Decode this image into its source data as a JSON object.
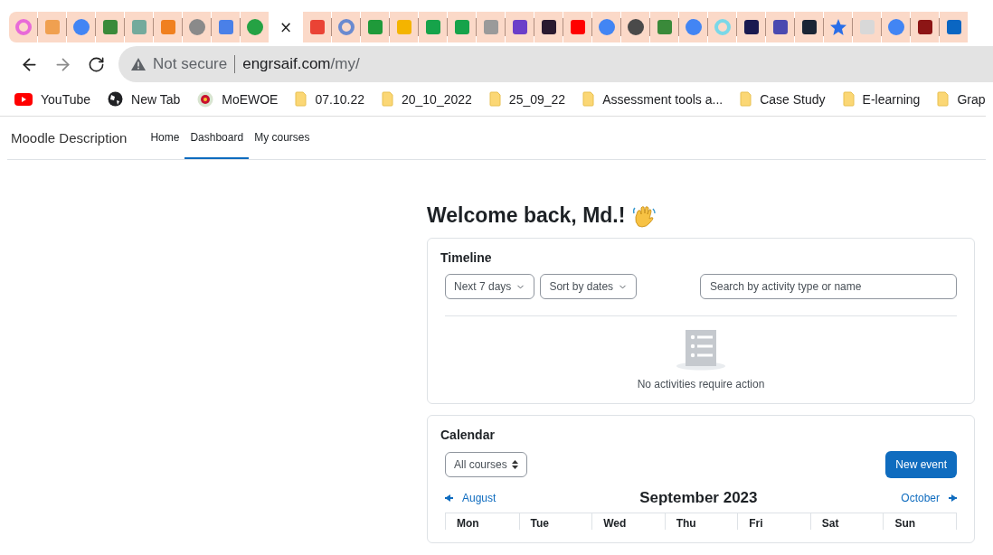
{
  "browser": {
    "tabs": [
      {
        "kind": "ring",
        "color": "#e86bd8",
        "selected": false
      },
      {
        "kind": "square",
        "color": "#f0a050",
        "selected": false
      },
      {
        "kind": "circle",
        "color": "#4285f4",
        "selected": false
      },
      {
        "kind": "square",
        "color": "#3a8a3a",
        "selected": false
      },
      {
        "kind": "square",
        "color": "#74aa9c",
        "selected": false
      },
      {
        "kind": "square",
        "color": "#f08020",
        "selected": false
      },
      {
        "kind": "circle",
        "color": "#8a8a8a",
        "selected": false
      },
      {
        "kind": "square",
        "color": "#4a80e8",
        "selected": false
      },
      {
        "kind": "circle",
        "color": "#25a244",
        "selected": false
      },
      {
        "kind": "close",
        "close": "×",
        "selected": true
      },
      {
        "kind": "square",
        "color": "#ea4335",
        "selected": false
      },
      {
        "kind": "ring",
        "color": "#6a8ad0",
        "selected": false
      },
      {
        "kind": "square",
        "color": "#1f9a3a",
        "selected": false
      },
      {
        "kind": "square",
        "color": "#f4b400",
        "selected": false
      },
      {
        "kind": "square",
        "color": "#16a34a",
        "selected": false
      },
      {
        "kind": "square",
        "color": "#16a34a",
        "selected": false
      },
      {
        "kind": "square",
        "color": "#9a9a9a",
        "selected": false
      },
      {
        "kind": "square",
        "color": "#6b3fc9",
        "selected": false
      },
      {
        "kind": "square",
        "color": "#2a1a30",
        "selected": false
      },
      {
        "kind": "square",
        "color": "#ff0000",
        "selected": false
      },
      {
        "kind": "circle",
        "color": "#4285f4",
        "selected": false
      },
      {
        "kind": "circle",
        "color": "#4a4a4a",
        "selected": false
      },
      {
        "kind": "square",
        "color": "#3a8a3a",
        "selected": false
      },
      {
        "kind": "circle",
        "color": "#4285f4",
        "selected": false
      },
      {
        "kind": "ring",
        "color": "#7ad8e8",
        "selected": false
      },
      {
        "kind": "square",
        "color": "#1a1a50",
        "selected": false
      },
      {
        "kind": "square",
        "color": "#4a4ab0",
        "selected": false
      },
      {
        "kind": "square",
        "color": "#1a2535",
        "selected": false
      },
      {
        "kind": "star",
        "color": "#2a6ee8",
        "selected": false
      },
      {
        "kind": "square",
        "color": "#d8d8d8",
        "selected": false
      },
      {
        "kind": "circle",
        "color": "#4285f4",
        "selected": false
      },
      {
        "kind": "square",
        "color": "#8c1515",
        "selected": false
      },
      {
        "kind": "square",
        "color": "#0a66c2",
        "selected": false
      }
    ],
    "nav_buttons": [
      {
        "kind": "back",
        "disabled": false
      },
      {
        "kind": "forward",
        "disabled": true
      },
      {
        "kind": "reload",
        "disabled": false
      }
    ],
    "security": "Not secure",
    "url_host": "engrsaif.com",
    "url_path": "/my/",
    "bookmarks": [
      {
        "kind": "youtube",
        "label": "YouTube"
      },
      {
        "kind": "globe",
        "label": "New Tab"
      },
      {
        "kind": "emblem",
        "label": "MoEWOE"
      },
      {
        "kind": "folder",
        "label": "07.10.22"
      },
      {
        "kind": "folder",
        "label": "20_10_2022"
      },
      {
        "kind": "folder",
        "label": "25_09_22"
      },
      {
        "kind": "folder",
        "label": "Assessment tools a..."
      },
      {
        "kind": "folder",
        "label": "Case Study"
      },
      {
        "kind": "folder",
        "label": "E-learning"
      },
      {
        "kind": "folder",
        "label": "Grap"
      }
    ]
  },
  "site": {
    "brand": "Moodle Description",
    "nav": [
      {
        "label": "Home",
        "selected": false
      },
      {
        "label": "Dashboard",
        "selected": true
      },
      {
        "label": "My courses",
        "selected": false
      }
    ]
  },
  "welcome": "Welcome back, Md.!",
  "timeline": {
    "title": "Timeline",
    "filters": [
      "Next 7 days",
      "Sort by dates"
    ],
    "search_placeholder": "Search by activity type or name",
    "empty_message": "No activities require action"
  },
  "calendar": {
    "title": "Calendar",
    "course_select": "All courses",
    "new_event": "New event",
    "prev": "August",
    "month": "September 2023",
    "next": "October",
    "weekdays": [
      "Mon",
      "Tue",
      "Wed",
      "Thu",
      "Fri",
      "Sat",
      "Sun"
    ]
  }
}
